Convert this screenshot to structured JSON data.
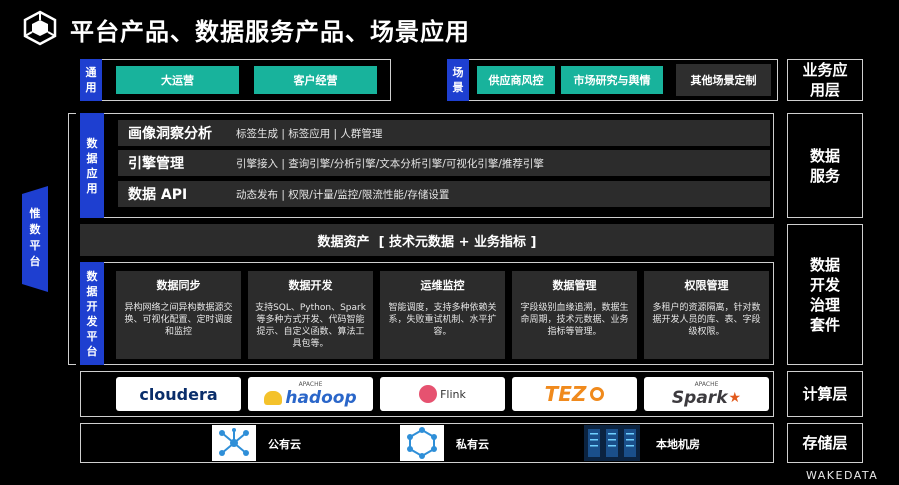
{
  "title": "平台产品、数据服务产品、场景应用",
  "brand": "WAKEDATA",
  "left_platform": "惟数平台",
  "apps": {
    "general_tab": "通用",
    "general": [
      "大运营",
      "客户经营"
    ],
    "scene_tab": "场景",
    "scene": [
      "供应商风控",
      "市场研究与舆情"
    ],
    "other": "其他场景定制",
    "layer_label": "业务应用层"
  },
  "data_app": {
    "tab": "数据应用",
    "rows": [
      {
        "name": "画像洞察分析",
        "desc": "标签生成  |  标签应用  |  人群管理"
      },
      {
        "name": "引擎管理",
        "desc": "引擎接入  |  查询引擎/分析引擎/文本分析引擎/可视化引擎/推荐引擎"
      },
      {
        "name": "数据 API",
        "desc": "动态发布  |  权限/计量/监控/限流性能/存储设置"
      }
    ],
    "layer_label": "数据服务"
  },
  "assets_bar": "数据资产  [ 技术元数据 + 业务指标 ]",
  "dev_platform": {
    "tab": "数据开发平台",
    "cards": [
      {
        "title": "数据同步",
        "desc": "异构网络之间异构数据源交换、可视化配置、定时调度和监控"
      },
      {
        "title": "数据开发",
        "desc": "支持SQL、Python、Spark等多种方式开发、代码智能提示、自定义函数、算法工具包等。"
      },
      {
        "title": "运维监控",
        "desc": "智能调度，支持多种依赖关系，失败重试机制、水平扩容。"
      },
      {
        "title": "数据管理",
        "desc": "字段级别血缘追溯，数据生命周期，技术元数据、业务指标等管理。"
      },
      {
        "title": "权限管理",
        "desc": "多租户的资源隔离，针对数据开发人员的库、表、字段级权限。"
      }
    ],
    "layer_label": "数据开发治理套件"
  },
  "compute": {
    "logos": [
      "cloudera",
      "hadoop",
      "Flink",
      "TEZ",
      "Spark"
    ],
    "logo_sub": {
      "hadoop_top": "APACHE",
      "spark_top": "APACHE"
    },
    "layer_label": "计算层"
  },
  "storage": {
    "items": [
      {
        "icon": "network-hub-icon",
        "label": "公有云"
      },
      {
        "icon": "hexagon-network-icon",
        "label": "私有云"
      },
      {
        "icon": "server-room-icon",
        "label": "本地机房"
      }
    ],
    "layer_label": "存储层"
  },
  "colors": {
    "accent_blue": "#1e3fd0",
    "teal": "#18b39c",
    "panel": "#2c2c2c"
  }
}
